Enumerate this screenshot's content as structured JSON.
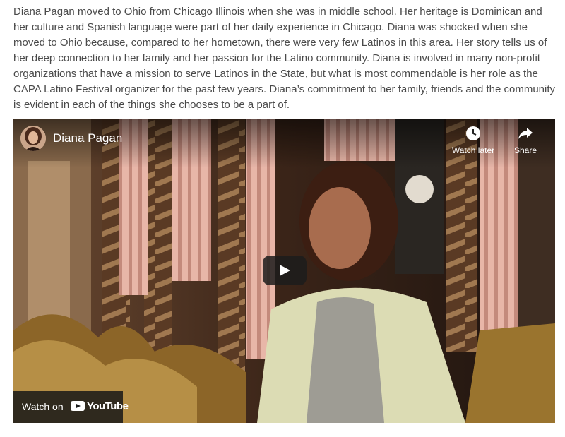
{
  "article": {
    "paragraph": "Diana Pagan moved to Ohio from Chicago Illinois when she was in middle school. Her heritage is Dominican and her culture and Spanish language were part of her daily experience in Chicago. Diana was shocked when she moved to Ohio because, compared to her hometown, there were very few Latinos in this area. Her story tells us of her deep connection to her family and her passion for the Latino community. Diana is involved in many non-profit organizations that have a mission to serve Latinos in the State, but what is most commendable is her role as the CAPA Latino Festival organizer for the past few years. Diana’s commitment to her family, friends and the community is evident in each of the things she chooses to be a part of."
  },
  "video": {
    "title": "Diana Pagan",
    "watch_later_label": "Watch later",
    "share_label": "Share",
    "watch_on_label": "Watch on",
    "platform_name": "YouTube",
    "icons": {
      "watch_later": "clock-icon",
      "share": "share-arrow-icon",
      "play": "play-icon",
      "platform": "youtube-logo-icon"
    }
  }
}
